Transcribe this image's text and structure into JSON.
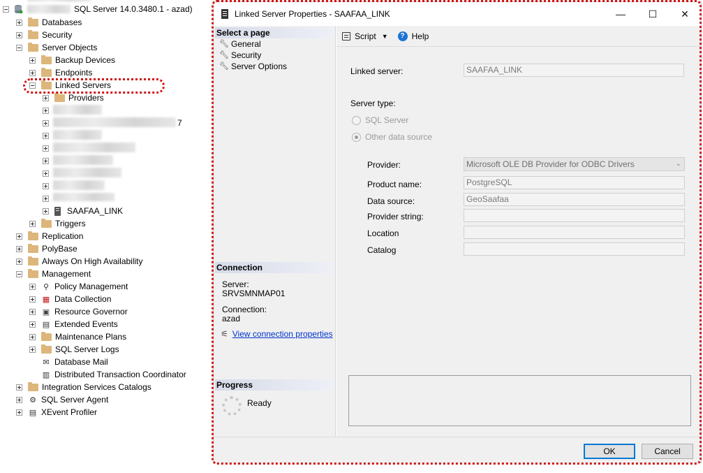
{
  "tree": {
    "server": "SQL Server 14.0.3480.1 - azad)",
    "items": [
      {
        "label": "Databases"
      },
      {
        "label": "Security"
      },
      {
        "label": "Server Objects"
      },
      {
        "label": "Backup Devices"
      },
      {
        "label": "Endpoints"
      },
      {
        "label": "Linked Servers"
      },
      {
        "label": "Providers"
      },
      {
        "label": "SAAFAA_LINK"
      },
      {
        "label": "Triggers"
      },
      {
        "label": "Replication"
      },
      {
        "label": "PolyBase"
      },
      {
        "label": "Always On High Availability"
      },
      {
        "label": "Management"
      },
      {
        "label": "Policy Management"
      },
      {
        "label": "Data Collection"
      },
      {
        "label": "Resource Governor"
      },
      {
        "label": "Extended Events"
      },
      {
        "label": "Maintenance Plans"
      },
      {
        "label": "SQL Server Logs"
      },
      {
        "label": "Database Mail"
      },
      {
        "label": "Distributed Transaction Coordinator"
      },
      {
        "label": "Integration Services Catalogs"
      },
      {
        "label": "SQL Server Agent"
      },
      {
        "label": "XEvent Profiler"
      }
    ],
    "blurred_suffix": "7"
  },
  "dialog": {
    "title": "Linked Server Properties - SAAFAA_LINK",
    "window_buttons": {
      "minimize": "—",
      "maximize": "☐",
      "close": "✕"
    },
    "left": {
      "select_page_header": "Select a page",
      "pages": [
        "General",
        "Security",
        "Server Options"
      ],
      "connection_header": "Connection",
      "server_label": "Server:",
      "server_value": "SRVSMNMAP01",
      "connection_label": "Connection:",
      "connection_value": "azad",
      "view_link": "View connection properties",
      "progress_header": "Progress",
      "progress_status": "Ready"
    },
    "toolbar": {
      "script": "Script",
      "help": "Help"
    },
    "form": {
      "linked_server_label": "Linked server:",
      "linked_server_value": "SAAFAA_LINK",
      "server_type_label": "Server type:",
      "radio_sql_server": "SQL Server",
      "radio_other": "Other data source",
      "provider_label": "Provider:",
      "provider_value": "Microsoft OLE DB Provider for ODBC Drivers",
      "product_name_label": "Product name:",
      "product_name_value": "PostgreSQL",
      "data_source_label": "Data source:",
      "data_source_value": "GeoSaafaa",
      "provider_string_label": "Provider string:",
      "provider_string_value": "",
      "location_label": "Location",
      "location_value": "",
      "catalog_label": "Catalog",
      "catalog_value": ""
    },
    "buttons": {
      "ok": "OK",
      "cancel": "Cancel"
    }
  },
  "colors": {
    "annotation_red": "#d01515",
    "link_blue": "#0033cc",
    "default_button": "#0078d7"
  }
}
